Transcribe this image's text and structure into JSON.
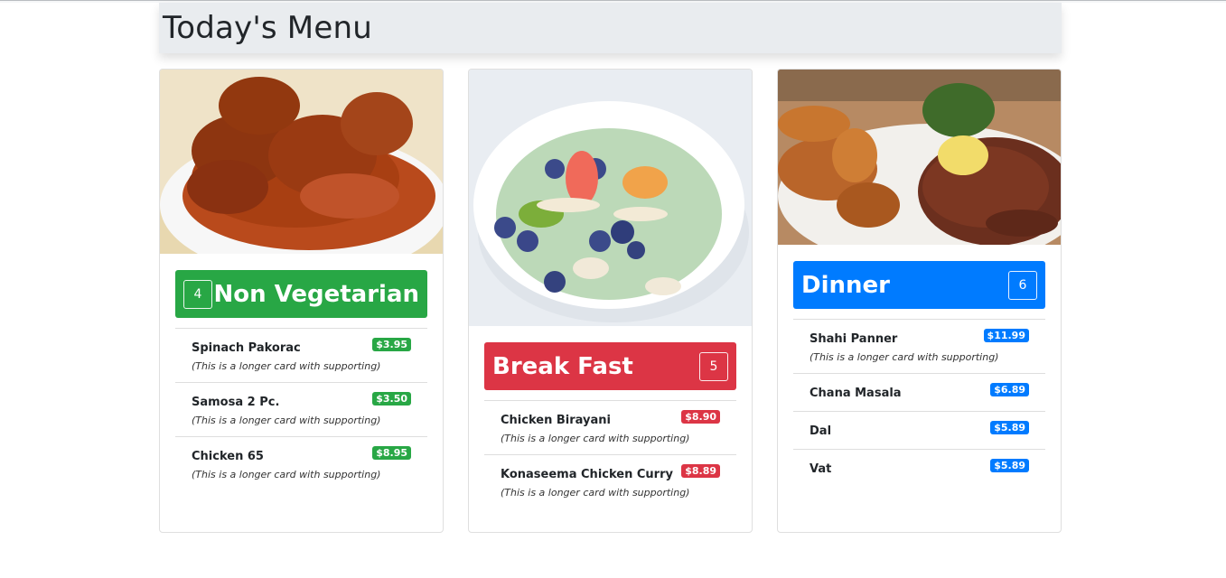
{
  "page": {
    "title": "Today's Menu"
  },
  "cards": [
    {
      "category": "Non Vegetarian",
      "count": "4",
      "color": "#28a745",
      "image": "chicken-curry-image",
      "items": [
        {
          "name": "Spinach Pakorac",
          "price": "$3.95",
          "desc": "(This is a longer card with supporting)"
        },
        {
          "name": "Samosa 2 Pc.",
          "price": "$3.50",
          "desc": "(This is a longer card with supporting)"
        },
        {
          "name": "Chicken 65",
          "price": "$8.95",
          "desc": "(This is a longer card with supporting)"
        }
      ]
    },
    {
      "category": "Break Fast",
      "count": "5",
      "color": "#dc3545",
      "image": "smoothie-bowl-image",
      "items": [
        {
          "name": "Chicken Birayani",
          "price": "$8.90",
          "desc": "(This is a longer card with supporting)"
        },
        {
          "name": "Konaseema Chicken Curry",
          "price": "$8.89",
          "desc": "(This is a longer card with supporting)"
        }
      ]
    },
    {
      "category": "Dinner",
      "count": "6",
      "color": "#007bff",
      "image": "steak-potatoes-image",
      "items": [
        {
          "name": "Shahi Panner",
          "price": "$11.99",
          "desc": "(This is a longer card with supporting)"
        },
        {
          "name": "Chana Masala",
          "price": "$6.89"
        },
        {
          "name": "Dal",
          "price": "$5.89"
        },
        {
          "name": "Vat",
          "price": "$5.89"
        }
      ]
    }
  ]
}
